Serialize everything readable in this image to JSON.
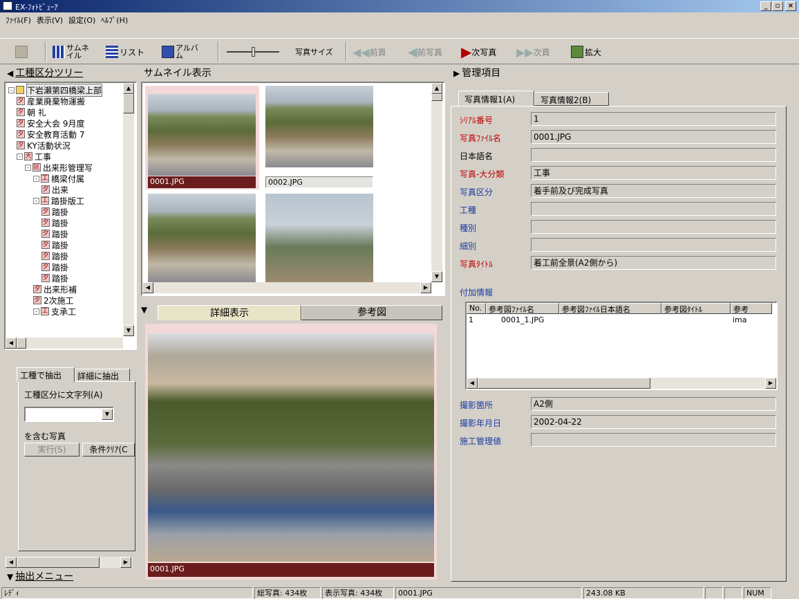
{
  "window": {
    "title": "EX-ﾌｫﾄﾋﾞｭｰｱ",
    "minimize": "_",
    "maximize": "▫",
    "close": "×"
  },
  "menu": [
    "ﾌｧｲﾙ(F)",
    "表示(V)",
    "設定(O)",
    "ﾍﾙﾌﾟ(H)"
  ],
  "toolbar": {
    "thumbnail": "サムネイル",
    "list": "リスト",
    "album": "アルバム",
    "photo_size": "写真サイズ",
    "prev_page": "前頁",
    "prev_photo": "前写真",
    "next_photo": "次写真",
    "next_page": "次頁",
    "zoom": "拡大"
  },
  "tree": {
    "header": "工種区分ツリー",
    "items": [
      {
        "label": "下岩瀬第四橋梁上部",
        "icon": "folder",
        "level": 0,
        "pm": "-"
      },
      {
        "label": "産業廃棄物運搬",
        "icon": "夕",
        "level": 1
      },
      {
        "label": "朝 礼",
        "icon": "夕",
        "level": 1
      },
      {
        "label": "安全大会 9月度",
        "icon": "夕",
        "level": 1
      },
      {
        "label": "安全教育活動 7",
        "icon": "夕",
        "level": 1
      },
      {
        "label": "KY活動状況",
        "icon": "夕",
        "level": 1
      },
      {
        "label": "工事",
        "icon": "大",
        "level": 1,
        "pm": "-"
      },
      {
        "label": "出来形管理写",
        "icon": "区",
        "level": 2,
        "pm": "-"
      },
      {
        "label": "橋梁付属",
        "icon": "工",
        "level": 3,
        "pm": "-"
      },
      {
        "label": "出来",
        "icon": "夕",
        "level": 4
      },
      {
        "label": "踏掛版工",
        "icon": "工",
        "level": 3,
        "pm": "-"
      },
      {
        "label": "踏掛",
        "icon": "夕",
        "level": 4
      },
      {
        "label": "踏掛",
        "icon": "夕",
        "level": 4
      },
      {
        "label": "踏掛",
        "icon": "夕",
        "level": 4
      },
      {
        "label": "踏掛",
        "icon": "夕",
        "level": 4
      },
      {
        "label": "踏掛",
        "icon": "夕",
        "level": 4
      },
      {
        "label": "踏掛",
        "icon": "夕",
        "level": 4
      },
      {
        "label": "踏掛",
        "icon": "夕",
        "level": 4
      },
      {
        "label": "出来形補",
        "icon": "夕",
        "level": 3
      },
      {
        "label": "2次施工",
        "icon": "夕",
        "level": 3
      },
      {
        "label": "支承工",
        "icon": "工",
        "level": 3,
        "pm": "-"
      }
    ]
  },
  "extract": {
    "tab1": "工種で抽出",
    "tab2": "詳細に抽出",
    "label": "工種区分に文字列(A)",
    "contains": "を含む写真",
    "run": "実行(S)",
    "clear": "条件ｸﾘｱ(C",
    "footer": "抽出メニュー"
  },
  "thumbs": {
    "header": "サムネイル表示",
    "items": [
      {
        "caption": "0001.JPG",
        "selected": true
      },
      {
        "caption": "0002.JPG",
        "selected": false
      },
      {
        "caption": "",
        "selected": false
      },
      {
        "caption": "",
        "selected": false
      }
    ]
  },
  "detail": {
    "tab1": "詳細表示",
    "tab2": "参考図",
    "caption": "0001.JPG"
  },
  "manage": {
    "header": "管理項目",
    "tab1": "写真情報1(A)",
    "tab2": "写真情報2(B)",
    "fields": [
      {
        "label": "ｼﾘｱﾙ番号",
        "value": "1",
        "color": "#c00000"
      },
      {
        "label": "写真ﾌｧｲﾙ名",
        "value": "0001.JPG",
        "color": "#c00000"
      },
      {
        "label": "日本語名",
        "value": "",
        "color": "#000000"
      },
      {
        "label": "写真-大分類",
        "value": "工事",
        "color": "#c00000"
      },
      {
        "label": "写真区分",
        "value": "着手前及び完成写真",
        "color": "#1a3aa0"
      },
      {
        "label": "工種",
        "value": "",
        "color": "#1a3aa0"
      },
      {
        "label": "種別",
        "value": "",
        "color": "#1a3aa0"
      },
      {
        "label": "細別",
        "value": "",
        "color": "#1a3aa0"
      },
      {
        "label": "写真ﾀｲﾄﾙ",
        "value": "着工前全景(A2側から)",
        "color": "#c00000"
      }
    ],
    "extra_label": "付加情報",
    "ref_cols": [
      "No.",
      "参考図ﾌｧｲﾙ名",
      "参考図ﾌｧｲﾙ日本語名",
      "参考図ﾀｲﾄﾙ",
      "参考"
    ],
    "ref_rows": [
      {
        "no": "1",
        "file": "0001_1.JPG",
        "jp": "",
        "title": "",
        "ref": "ima"
      }
    ],
    "fields2": [
      {
        "label": "撮影箇所",
        "value": "A2側",
        "color": "#1a3aa0"
      },
      {
        "label": "撮影年月日",
        "value": "2002-04-22",
        "color": "#1a3aa0"
      },
      {
        "label": "施工管理値",
        "value": "",
        "color": "#1a3aa0"
      }
    ]
  },
  "status": {
    "ready": "ﾚﾃﾞｨ",
    "total": "総写真: 434枚",
    "shown": "表示写真: 434枚",
    "file": "0001.JPG",
    "size": "243.08 KB",
    "num": "NUM"
  }
}
